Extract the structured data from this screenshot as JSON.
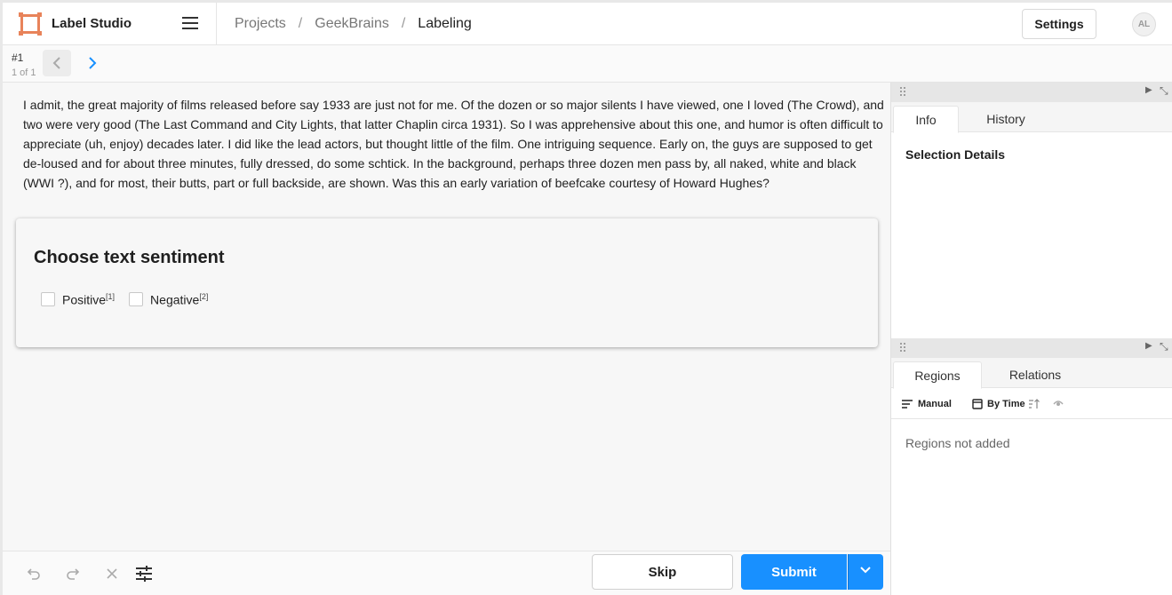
{
  "header": {
    "app_title": "Label Studio",
    "breadcrumb": [
      "Projects",
      "GeekBrains",
      "Labeling"
    ],
    "settings_label": "Settings",
    "avatar_initials": "AL"
  },
  "task": {
    "id": "#1",
    "count": "1 of 1"
  },
  "content": {
    "text": "I admit, the great majority of films released before say 1933 are just not for me. Of the dozen or so major silents I have viewed, one I loved (The Crowd), and two were very good (The Last Command and City Lights, that latter Chaplin circa 1931). So I was apprehensive about this one, and humor is often difficult to appreciate (uh, enjoy) decades later. I did like the lead actors, but thought little of the film. One intriguing sequence. Early on, the guys are supposed to get de-loused and for about three minutes, fully dressed, do some schtick. In the background, perhaps three dozen men pass by, all naked, white and black (WWI ?), and for most, their butts, part or full backside, are shown. Was this an early variation of beefcake courtesy of Howard Hughes?"
  },
  "annotation": {
    "title": "Choose text sentiment",
    "choices": [
      {
        "label": "Positive",
        "hotkey": "[1]",
        "checked": false
      },
      {
        "label": "Negative",
        "hotkey": "[2]",
        "checked": false
      }
    ]
  },
  "toolbar": {
    "skip_label": "Skip",
    "submit_label": "Submit"
  },
  "side": {
    "top_tabs": [
      "Info",
      "History"
    ],
    "selection_details": "Selection Details",
    "bottom_tabs": [
      "Regions",
      "Relations"
    ],
    "order_label": "Manual",
    "sort_label": "By Time",
    "regions_empty": "Regions not added"
  },
  "colors": {
    "accent": "#1890ff",
    "logo": "#e8835a"
  }
}
